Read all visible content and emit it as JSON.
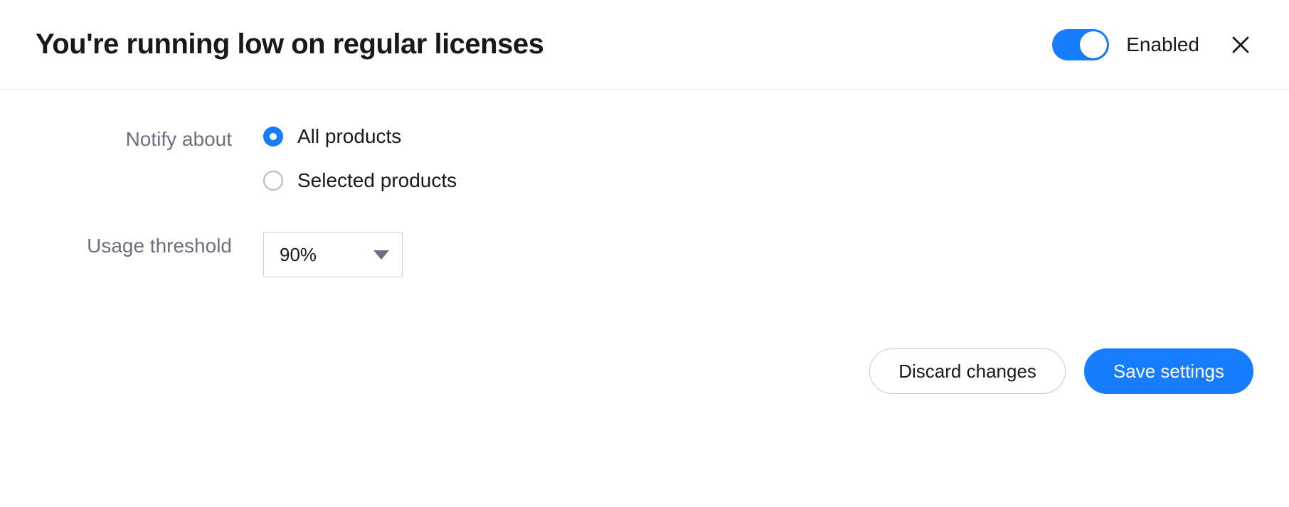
{
  "header": {
    "title": "You're running low on regular licenses",
    "toggle_label": "Enabled",
    "toggle_on": true
  },
  "form": {
    "notify_about": {
      "label": "Notify about",
      "option_all": "All products",
      "option_selected": "Selected products",
      "checked": "all"
    },
    "usage_threshold": {
      "label": "Usage threshold",
      "value": "90%"
    }
  },
  "footer": {
    "discard": "Discard changes",
    "save": "Save settings"
  }
}
